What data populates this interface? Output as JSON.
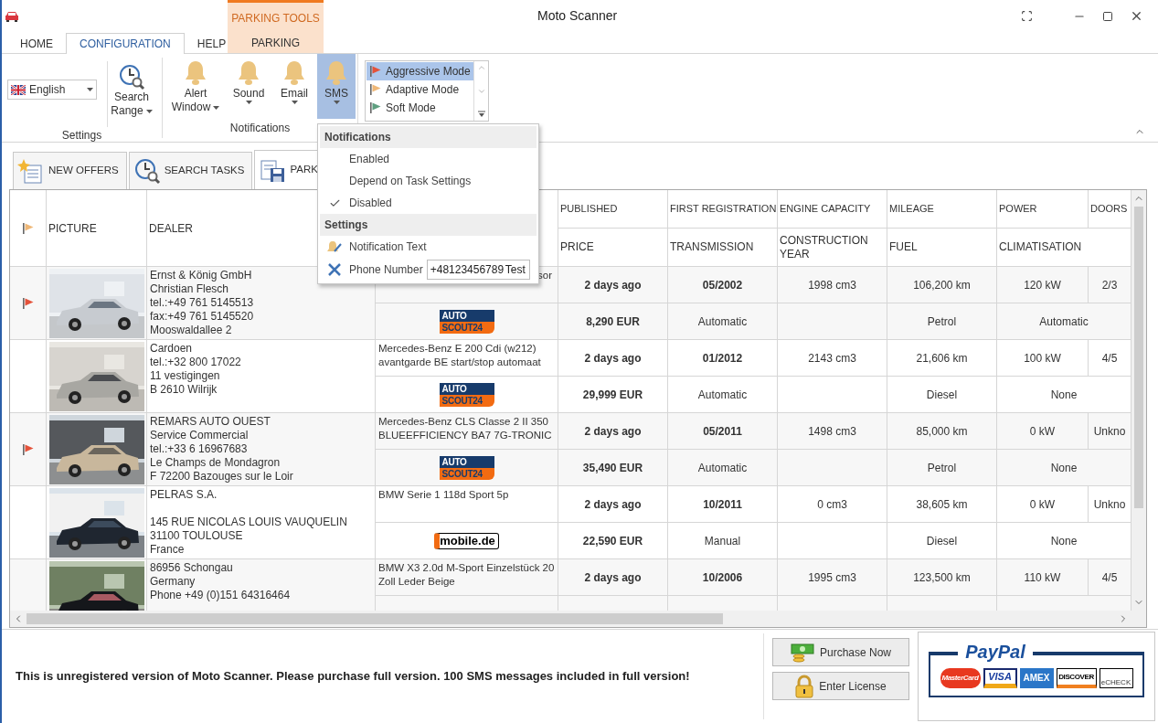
{
  "window": {
    "title": "Moto Scanner"
  },
  "contextual_group": {
    "title": "PARKING TOOLS"
  },
  "ribbon_tabs": [
    {
      "label": "HOME",
      "selected": false,
      "kind": "normal"
    },
    {
      "label": "CONFIGURATION",
      "selected": true,
      "kind": "normal"
    },
    {
      "label": "HELP",
      "selected": false,
      "kind": "normal"
    },
    {
      "label": "PARKING",
      "selected": false,
      "kind": "contextual"
    }
  ],
  "ribbon": {
    "settings": {
      "label": "Settings",
      "language": "English",
      "button": {
        "label": [
          "Search",
          "Range"
        ],
        "kind": "search",
        "expanded": false
      }
    },
    "notifications": {
      "label": "Notifications",
      "buttons": [
        {
          "label": [
            "Alert",
            "Window"
          ],
          "kind": "bell",
          "expanded": false
        },
        {
          "label": [
            "Sound"
          ],
          "kind": "bell",
          "expanded": false
        },
        {
          "label": [
            "Email"
          ],
          "kind": "bell",
          "expanded": false
        },
        {
          "label": [
            "SMS"
          ],
          "kind": "bell",
          "expanded": true
        }
      ]
    },
    "modes": [
      {
        "label": "Aggressive Mode",
        "color": "#e4523a",
        "selected": true
      },
      {
        "label": "Adaptive Mode",
        "color": "#efb878",
        "selected": false
      },
      {
        "label": "Soft Mode",
        "color": "#5f9f80",
        "selected": false
      }
    ]
  },
  "menu": {
    "sections": [
      {
        "title": "Notifications",
        "items": [
          {
            "label": "Enabled",
            "kind": "option",
            "checked": false
          },
          {
            "label": "Depend on Task Settings",
            "kind": "option",
            "checked": false
          },
          {
            "label": "Disabled",
            "kind": "option",
            "checked": true
          }
        ]
      },
      {
        "title": "Settings",
        "items": [
          {
            "label": "Notification Text",
            "kind": "edit"
          },
          {
            "label": "Phone Number",
            "kind": "phone",
            "value": "+48123456789",
            "button": "Test"
          }
        ]
      }
    ]
  },
  "view_tabs": [
    {
      "label": "NEW OFFERS",
      "kind": "offers",
      "selected": false
    },
    {
      "label": "SEARCH TASKS",
      "kind": "search",
      "selected": false
    },
    {
      "label": "PARK",
      "kind": "parking",
      "selected": true
    }
  ],
  "table": {
    "columns": {
      "picture": "PICTURE",
      "dealer": "DEALER",
      "top": [
        "PUBLISHED",
        "FIRST REGISTRATION",
        "ENGINE CAPACITY",
        "MILEAGE",
        "POWER",
        "DOORS"
      ],
      "bottom": [
        "PRICE",
        "TRANSMISSION",
        "CONSTRUCTION YEAR",
        "FUEL",
        "CLIMATISATION"
      ]
    },
    "rows": [
      {
        "flagged": true,
        "dealer": [
          [
            "Ernst & König GmbH",
            "Christian Flesch",
            "tel.:+49 761 5145513",
            "fax:+49 761 5145520",
            "Mooswaldallee 2"
          ]
        ],
        "title": "sor",
        "title_cut": true,
        "source": {
          "kind": "autoscout",
          "lines": [
            "AUTO",
            "SCOUT24"
          ]
        },
        "top": [
          "2 days ago",
          "05/2002",
          "1998 cm3",
          "106,200 km",
          "120 kW",
          "2/3"
        ],
        "bottom": {
          "price": "8,290 EUR",
          "transmission": "Automatic",
          "fuel": "Petrol",
          "climatisation": "Automatic"
        }
      },
      {
        "flagged": false,
        "dealer": [
          [
            "Cardoen",
            "tel.:+32 800 17022",
            "11 vestigingen",
            "B 2610 Wilrijk"
          ]
        ],
        "title": "Mercedes-Benz E 200 Cdi (w212) avantgarde BE start/stop automaat",
        "title_cut": false,
        "source": {
          "kind": "autoscout",
          "lines": [
            "AUTO",
            "SCOUT24"
          ]
        },
        "top": [
          "2 days ago",
          "01/2012",
          "2143 cm3",
          "21,606 km",
          "100 kW",
          "4/5"
        ],
        "bottom": {
          "price": "29,999 EUR",
          "transmission": "Automatic",
          "fuel": "Diesel",
          "climatisation": "None"
        }
      },
      {
        "flagged": true,
        "dealer": [
          [
            "REMARS AUTO OUEST",
            "Service Commercial",
            "tel.:+33 6 16967683",
            "Le Champs de Mondagron",
            "F 72200 Bazouges sur le Loir"
          ]
        ],
        "title": "Mercedes-Benz CLS Classe  2 II 350 BLUEEFFICIENCY BA7 7G-TRONIC",
        "title_cut": false,
        "source": {
          "kind": "autoscout",
          "lines": [
            "AUTO",
            "SCOUT24"
          ]
        },
        "top": [
          "2 days ago",
          "05/2011",
          "1498 cm3",
          "85,000 km",
          "0 kW",
          "Unkno"
        ],
        "bottom": {
          "price": "35,490 EUR",
          "transmission": "Automatic",
          "fuel": "Petrol",
          "climatisation": "None"
        }
      },
      {
        "flagged": false,
        "dealer": [
          [
            "PELRAS S.A."
          ],
          [
            "145 RUE NICOLAS LOUIS VAUQUELIN",
            "31100 TOULOUSE",
            "France"
          ]
        ],
        "title": "BMW Serie 1 118d Sport 5p",
        "title_cut": false,
        "source": {
          "kind": "mobile",
          "lines": [
            "mobile.de"
          ]
        },
        "top": [
          "2 days ago",
          "10/2011",
          "0 cm3",
          "38,605 km",
          "0 kW",
          "Unkno"
        ],
        "bottom": {
          "price": "22,590 EUR",
          "transmission": "Manual",
          "fuel": "Diesel",
          "climatisation": "None"
        }
      },
      {
        "flagged": false,
        "dealer": [
          [
            "86956 Schongau",
            "Germany",
            "Phone +49 (0)151 64316464"
          ]
        ],
        "title": "BMW X3 2.0d M-Sport Einzelstück 20 Zoll Leder Beige",
        "title_cut": false,
        "top": [
          "2 days ago",
          "10/2006",
          "1995 cm3",
          "123,500 km",
          "110 kW",
          "4/5"
        ]
      }
    ]
  },
  "notice": "This is unregistered version of Moto Scanner. Please purchase full version. 100 SMS messages included in full version!",
  "actions": [
    {
      "label": "Purchase Now",
      "kind": "purchase"
    },
    {
      "label": "Enter License",
      "kind": "license"
    }
  ],
  "paypal": {
    "logo": "PayPal",
    "cards": [
      {
        "label": "MasterCard",
        "kind": "mastercard"
      },
      {
        "label": "VISA",
        "kind": "visa"
      },
      {
        "label": "AMEX",
        "kind": "amex"
      },
      {
        "label": "DISCOVER",
        "kind": "discover"
      },
      {
        "label": "eCHECK",
        "kind": "echeck"
      }
    ]
  }
}
